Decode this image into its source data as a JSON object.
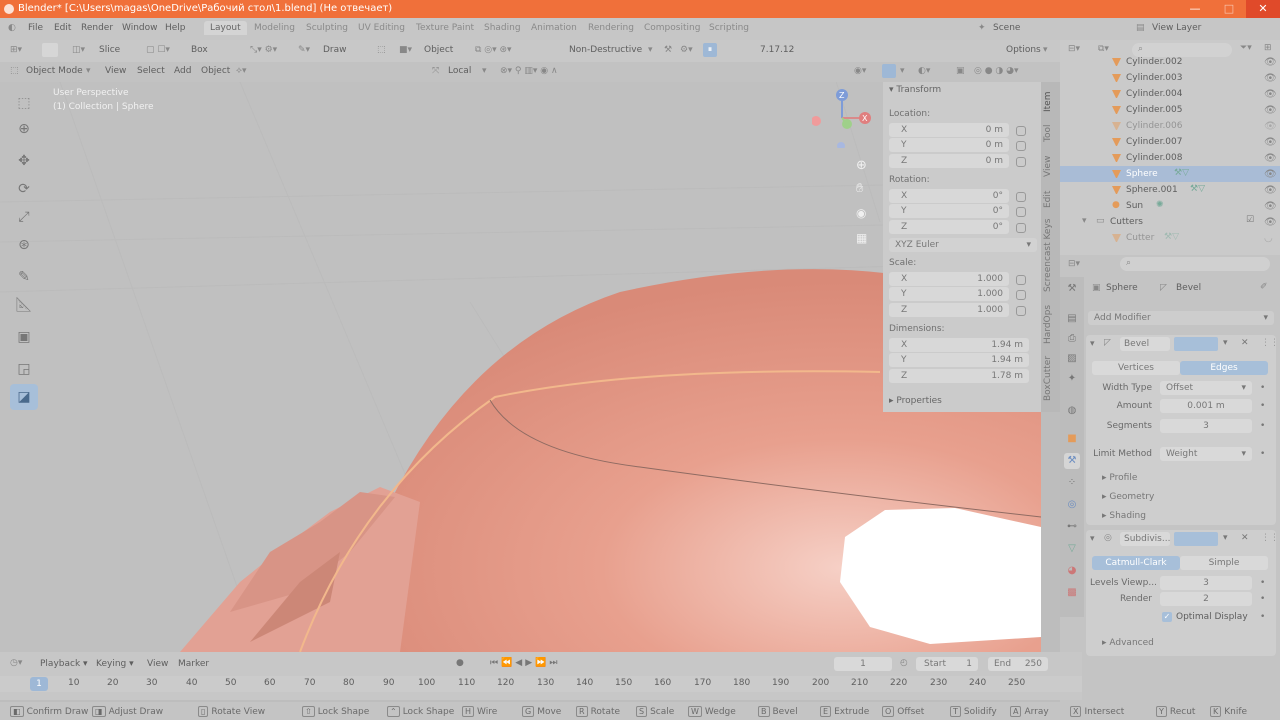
{
  "window": {
    "title": "Blender* [C:\\Users\\magas\\OneDrive\\Рабочий стол\\1.blend] (Не отвечает)",
    "minimize": "—",
    "maximize": "□",
    "close": "✕"
  },
  "menu": {
    "file": "File",
    "edit": "Edit",
    "render": "Render",
    "window": "Window",
    "help": "Help"
  },
  "workspaces": [
    "Layout",
    "Modeling",
    "Sculpting",
    "UV Editing",
    "Texture Paint",
    "Shading",
    "Animation",
    "Rendering",
    "Compositing",
    "Scripting"
  ],
  "scene": {
    "scene_name": "Scene",
    "view_layer": "View Layer"
  },
  "tool_header": {
    "slice": "Slice",
    "box": "Box",
    "draw": "Draw",
    "object": "Object",
    "mode": "Non-Destructive",
    "version": "7.17.12",
    "options": "Options"
  },
  "viewport_header": {
    "mode": "Object Mode",
    "view": "View",
    "select": "Select",
    "add": "Add",
    "object": "Object",
    "orientation": "Local"
  },
  "viewport": {
    "perspective": "User Perspective",
    "collection": "(1) Collection | Sphere"
  },
  "npanel": {
    "transform_title": "Transform",
    "location_label": "Location:",
    "location": [
      {
        "axis": "X",
        "value": "0 m"
      },
      {
        "axis": "Y",
        "value": "0 m"
      },
      {
        "axis": "Z",
        "value": "0 m"
      }
    ],
    "rotation_label": "Rotation:",
    "rotation": [
      {
        "axis": "X",
        "value": "0°"
      },
      {
        "axis": "Y",
        "value": "0°"
      },
      {
        "axis": "Z",
        "value": "0°"
      }
    ],
    "rotation_mode": "XYZ Euler",
    "scale_label": "Scale:",
    "scale": [
      {
        "axis": "X",
        "value": "1.000"
      },
      {
        "axis": "Y",
        "value": "1.000"
      },
      {
        "axis": "Z",
        "value": "1.000"
      }
    ],
    "dimensions_label": "Dimensions:",
    "dimensions": [
      {
        "axis": "X",
        "value": "1.94 m"
      },
      {
        "axis": "Y",
        "value": "1.94 m"
      },
      {
        "axis": "Z",
        "value": "1.78 m"
      }
    ],
    "properties_title": "Properties",
    "tabs": [
      "Item",
      "Tool",
      "View",
      "Edit",
      "Screencast Keys",
      "HardOps",
      "BoxCutter"
    ]
  },
  "outliner": {
    "items": [
      {
        "name": "Cylinder.002"
      },
      {
        "name": "Cylinder.003"
      },
      {
        "name": "Cylinder.004"
      },
      {
        "name": "Cylinder.005"
      },
      {
        "name": "Cylinder.006"
      },
      {
        "name": "Cylinder.007"
      },
      {
        "name": "Cylinder.008"
      },
      {
        "name": "Sphere"
      },
      {
        "name": "Sphere.001"
      },
      {
        "name": "Sun"
      },
      {
        "name": "Cutters"
      },
      {
        "name": "Cutter"
      }
    ]
  },
  "properties": {
    "object": "Sphere",
    "modifier_context": "Bevel",
    "add_modifier": "Add Modifier",
    "bevel": {
      "name": "Bevel",
      "tab_vertices": "Vertices",
      "tab_edges": "Edges",
      "width_type_label": "Width Type",
      "width_type": "Offset",
      "amount_label": "Amount",
      "amount": "0.001 m",
      "segments_label": "Segments",
      "segments": "3",
      "limit_method_label": "Limit Method",
      "limit_method": "Weight",
      "profile": "Profile",
      "geometry": "Geometry",
      "shading": "Shading"
    },
    "subdiv": {
      "name": "Subdivis...",
      "tab_cc": "Catmull-Clark",
      "tab_simple": "Simple",
      "levels_label": "Levels Viewp...",
      "levels": "3",
      "render_label": "Render",
      "render": "2",
      "optimal_display": "Optimal Display",
      "advanced": "Advanced"
    }
  },
  "timeline": {
    "playback": "Playback",
    "keying": "Keying",
    "view": "View",
    "marker": "Marker",
    "current": "1",
    "start_label": "Start",
    "start": "1",
    "end_label": "End",
    "end": "250",
    "ticks": [
      "1",
      "10",
      "20",
      "30",
      "40",
      "50",
      "60",
      "70",
      "80",
      "90",
      "100",
      "110",
      "120",
      "130",
      "140",
      "150",
      "160",
      "170",
      "180",
      "190",
      "200",
      "210",
      "220",
      "230",
      "240",
      "250"
    ]
  },
  "statusbar": [
    {
      "key": "",
      "label": "Confirm Draw"
    },
    {
      "key": "",
      "label": "Adjust Draw"
    },
    {
      "key": "",
      "label": "Rotate View"
    },
    {
      "key": "",
      "label": "Lock Shape"
    },
    {
      "key": "",
      "label": "Lock Shape"
    },
    {
      "key": "H",
      "label": "Wire"
    },
    {
      "key": "G",
      "label": "Move"
    },
    {
      "key": "R",
      "label": "Rotate"
    },
    {
      "key": "S",
      "label": "Scale"
    },
    {
      "key": "W",
      "label": "Wedge"
    },
    {
      "key": "B",
      "label": "Bevel"
    },
    {
      "key": "E",
      "label": "Extrude"
    },
    {
      "key": "O",
      "label": "Offset"
    },
    {
      "key": "T",
      "label": "Solidify"
    },
    {
      "key": "A",
      "label": "Array"
    },
    {
      "key": "X",
      "label": "Intersect"
    },
    {
      "key": "Y",
      "label": "Recut"
    },
    {
      "key": "K",
      "label": "Knife"
    }
  ],
  "colors": {
    "titlebar": "#f0703a",
    "accent": "#a7bfd9",
    "mesh": "#e79a88"
  }
}
